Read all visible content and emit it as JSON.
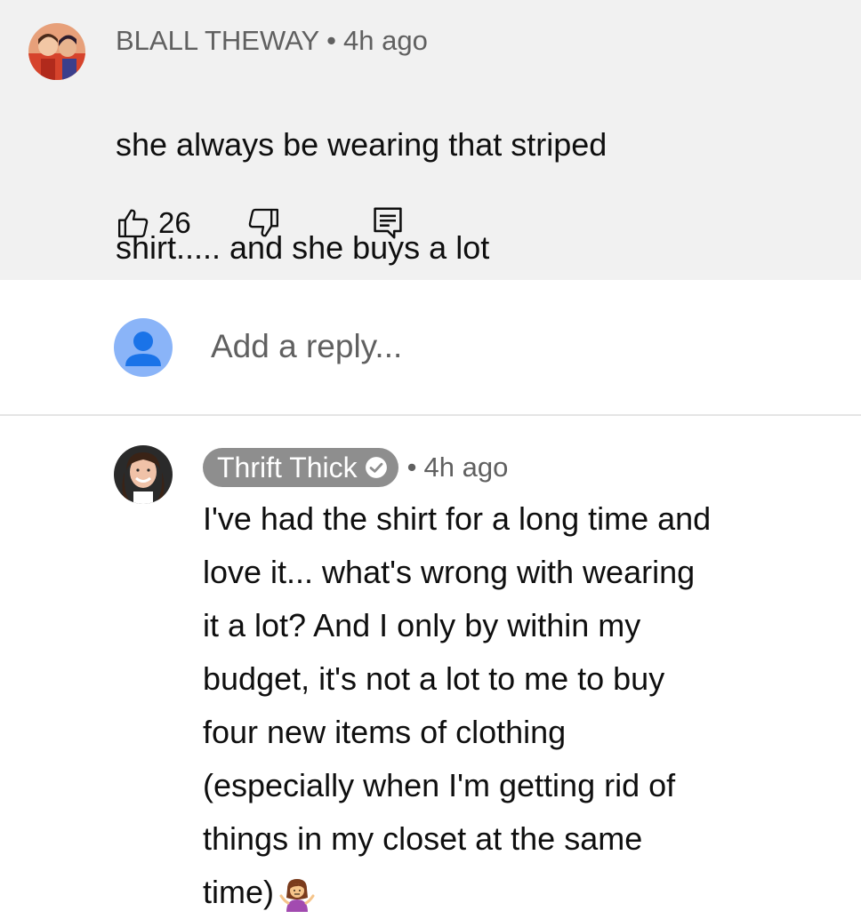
{
  "top_comment": {
    "author": "BLALL THEWAY",
    "separator": "•",
    "time": "4h ago",
    "text_lines": [
      "she always be wearing that striped",
      "shirt..... and she buys a lot"
    ],
    "like_count": "26",
    "icons": {
      "like": "thumbs-up-icon",
      "dislike": "thumbs-down-icon",
      "reply": "comment-icon"
    }
  },
  "reply_box": {
    "placeholder": "Add a reply..."
  },
  "reply_comment": {
    "author": "Thrift Thick",
    "separator": "•",
    "time": "4h ago",
    "text_lines": [
      "I've had the shirt for a long time and",
      "love it... what's wrong with wearing",
      "it a lot? And I only by within my",
      "budget, it's not a lot to me to buy",
      "four new items of clothing",
      "(especially when I'm getting rid of",
      "things in my closet at the same",
      "time)"
    ],
    "emoji": "person-shrugging-emoji",
    "verified_icon": "verified-check-icon"
  },
  "colors": {
    "top_bg": "#f1f1f1",
    "meta_text": "#606060",
    "chip_bg": "#8e8e8e",
    "avatar_placeholder": "#8ab4f8"
  }
}
